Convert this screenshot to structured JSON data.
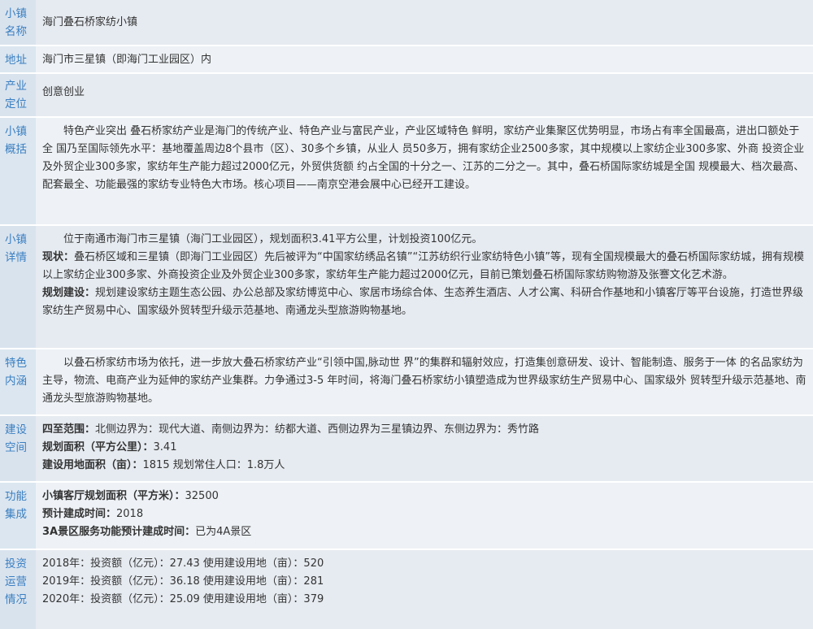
{
  "rows": {
    "name": {
      "label": [
        "小镇",
        "名称"
      ],
      "value": "海门叠石桥家纺小镇"
    },
    "address": {
      "label": [
        "地址"
      ],
      "value": "海门市三星镇（即海门工业园区）内"
    },
    "industry": {
      "label": [
        "产业",
        "定位"
      ],
      "value": "创意创业"
    },
    "overview": {
      "label": [
        "小镇",
        "概括"
      ],
      "text": "特色产业突出 叠石桥家纺产业是海门的传统产业、特色产业与富民产业，产业区域特色 鲜明，家纺产业集聚区优势明显，市场占有率全国最高，进出口额处于全 国乃至国际领先水平：基地覆盖周边8个县市（区）、30多个乡镇，从业人 员50多万，拥有家纺企业2500多家，其中规模以上家纺企业300多家、外商 投资企业及外贸企业300多家，家纺年生产能力超过2000亿元，外贸供货额 约占全国的十分之一、江苏的二分之一。其中，叠石桥国际家纺城是全国 规模最大、档次最高、配套最全、功能最强的家纺专业特色大市场。核心项目——南京空港会展中心已经开工建设。"
    },
    "detail": {
      "label": [
        "小镇",
        "详情"
      ],
      "intro": "位于南通市海门市三星镇（海门工业园区），规划面积3.41平方公里，计划投资100亿元。",
      "status_label": "现状：",
      "status_text": "叠石桥区域和三星镇（即海门工业园区）先后被评为“中国家纺绣品名镇”“江苏纺织行业家纺特色小镇”等，现有全国规模最大的叠石桥国际家纺城，拥有规模以上家纺企业300多家、外商投资企业及外贸企业300多家，家纺年生产能力超过2000亿元，目前已策划叠石桥国际家纺购物游及张謇文化艺术游。",
      "plan_label": "规划建设：",
      "plan_text": "规划建设家纺主题生态公园、办公总部及家纺博览中心、家居市场综合体、生态养生酒店、人才公寓、科研合作基地和小镇客厅等平台设施，打造世界级家纺生产贸易中心、国家级外贸转型升级示范基地、南通龙头型旅游购物基地。"
    },
    "features": {
      "label": [
        "特色",
        "内涵"
      ],
      "text": "以叠石桥家纺市场为依托，进一步放大叠石桥家纺产业“引领中国,脉动世 界”的集群和辐射效应，打造集创意研发、设计、智能制造、服务于一体 的名品家纺为主导，物流、电商产业为延伸的家纺产业集群。力争通过3-5 年时间，将海门叠石桥家纺小镇塑造成为世界级家纺生产贸易中心、国家级外 贸转型升级示范基地、南通龙头型旅游购物基地。"
    },
    "space": {
      "label": [
        "建设",
        "空间"
      ],
      "boundary_label": "四至范围：",
      "boundary_text": "北侧边界为：现代大道、南侧边界为：纺都大道、西侧边界为三星镇边界、东侧边界为：秀竹路",
      "area_label": "规划面积（平方公里）：",
      "area_value": "3.41",
      "land_label": "建设用地面积（亩）：",
      "land_text": "1815 规划常住人口：1.8万人"
    },
    "function": {
      "label": [
        "功能",
        "集成"
      ],
      "hall_label": "小镇客厅规划面积（平方米）：",
      "hall_value": "32500",
      "completion_label": "预计建成时间：",
      "completion_value": "2018",
      "scenic_label": "3A景区服务功能预计建成时间：",
      "scenic_value": "已为4A景区"
    },
    "investment": {
      "label": [
        "投资",
        "运营",
        "情况"
      ],
      "lines": [
        "2018年：投资额（亿元）：27.43 使用建设用地（亩）：520",
        "2019年：投资额（亿元）：36.18 使用建设用地（亩）：281",
        "2020年：投资额（亿元）：25.09 使用建设用地（亩）：379"
      ]
    }
  }
}
